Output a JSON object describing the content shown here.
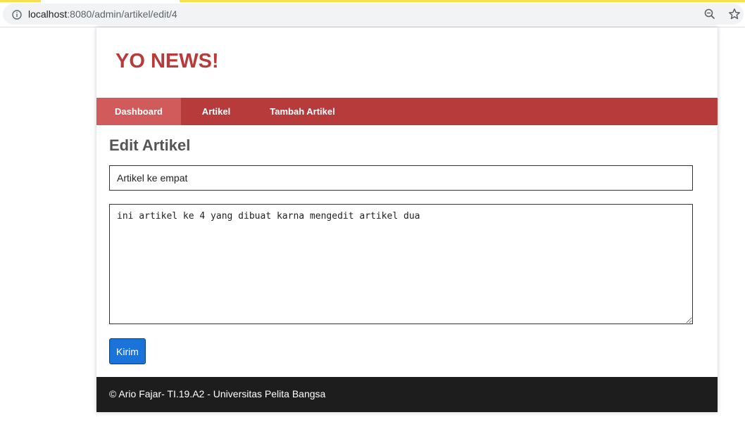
{
  "browser": {
    "url_host": "localhost",
    "url_path": ":8080/admin/artikel/edit/4",
    "icons": {
      "info": "info-icon",
      "zoom": "zoom-icon",
      "bookmark": "star-icon"
    }
  },
  "site": {
    "title": "YO NEWS!",
    "brand_color": "#b83b3b"
  },
  "nav": {
    "items": [
      {
        "label": "Dashboard",
        "active": true
      },
      {
        "label": "Artikel",
        "active": false
      },
      {
        "label": "Tambah Artikel",
        "active": false
      }
    ]
  },
  "form": {
    "heading": "Edit Artikel",
    "title_value": "Artikel ke empat",
    "content_value": "ini artikel ke 4 yang dibuat karna mengedit artikel dua",
    "submit_label": "Kirim",
    "submit_color": "#1a73d9"
  },
  "footer": {
    "text": "© Ario Fajar- TI.19.A2 - Universitas Pelita Bangsa"
  }
}
